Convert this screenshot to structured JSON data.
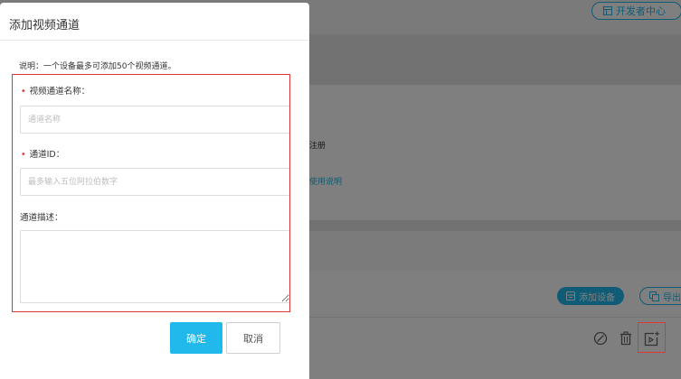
{
  "colors": {
    "accent": "#21b9ec",
    "error": "#e23636",
    "overlay": "rgba(0,0,0,0.5)"
  },
  "header": {
    "dev_center_label": "开发者中心",
    "dev_center_icon": "grid-icon"
  },
  "background": {
    "register_text": "注册",
    "usage_link": "使用说明",
    "add_device_label": "添加设备",
    "export_label": "导出",
    "row_icons": [
      "edit-icon",
      "trash-icon",
      "add-channel-icon"
    ]
  },
  "dialog": {
    "title": "添加视频通道",
    "note": "说明：一个设备最多可添加50个视频通道。",
    "fields": {
      "channel_name": {
        "required_mark": "•",
        "label": "视频通道名称：",
        "value": "",
        "placeholder": "通道名称"
      },
      "channel_id": {
        "required_mark": "•",
        "label": "通道ID：",
        "value": "",
        "placeholder": "最多输入五位阿拉伯数字"
      },
      "description": {
        "label": "通道描述：",
        "value": ""
      }
    },
    "ok_label": "确定",
    "cancel_label": "取消"
  }
}
